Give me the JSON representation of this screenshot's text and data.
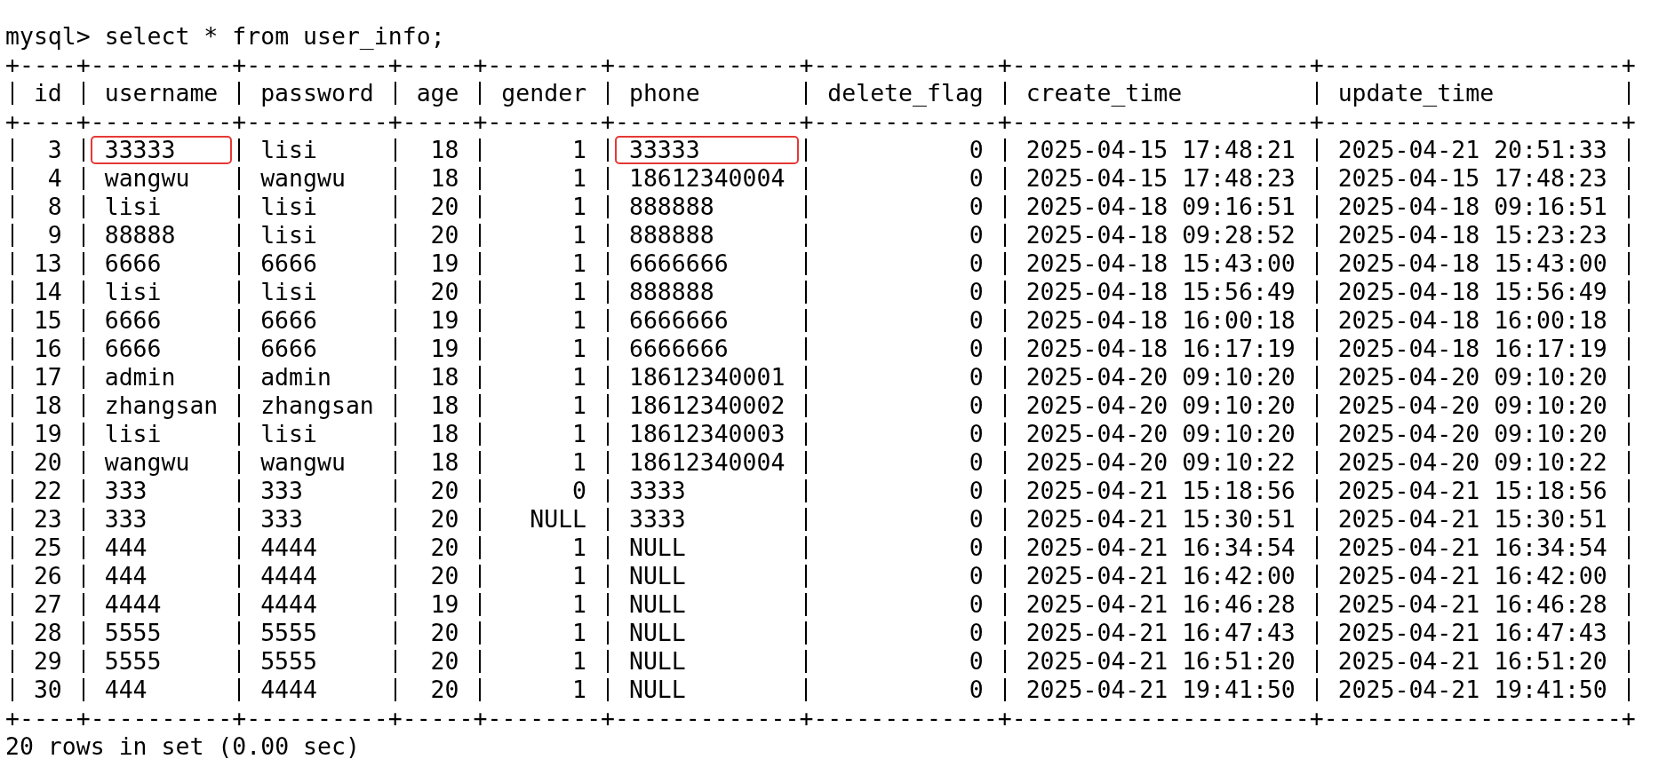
{
  "prompt": "mysql> select * from user_info;",
  "table": {
    "top_border": "+----+----------+----------+-----+--------+-------------+-------------+---------------------+---------------------+",
    "columns": [
      {
        "label": "id",
        "right_aligned": true
      },
      {
        "label": "username",
        "right_aligned": false
      },
      {
        "label": "password",
        "right_aligned": false
      },
      {
        "label": "age",
        "right_aligned": true
      },
      {
        "label": "gender",
        "right_aligned": true
      },
      {
        "label": "phone",
        "right_aligned": false
      },
      {
        "label": "delete_flag",
        "right_aligned": true
      },
      {
        "label": "create_time"
      },
      {
        "label": "update_time"
      }
    ],
    "header_border": "+----+----------+----------+-----+--------+-------------+-------------+---------------------+---------------------+",
    "rows": [
      {
        "cells": [
          "3",
          "33333",
          "lisi",
          "18",
          "1",
          "33333",
          "0",
          "2025-04-15 17:48:21",
          "2025-04-21 20:51:33"
        ],
        "marked": [
          false,
          true,
          false,
          false,
          false,
          true,
          false,
          false,
          false
        ]
      },
      {
        "cells": [
          "4",
          "wangwu",
          "wangwu",
          "18",
          "1",
          "18612340004",
          "0",
          "2025-04-15 17:48:23",
          "2025-04-15 17:48:23"
        ],
        "marked": [
          false,
          false,
          false,
          false,
          false,
          false,
          false,
          false,
          false
        ]
      },
      {
        "cells": [
          "8",
          "lisi",
          "lisi",
          "20",
          "1",
          "888888",
          "0",
          "2025-04-18 09:16:51",
          "2025-04-18 09:16:51"
        ],
        "marked": [
          false,
          false,
          false,
          false,
          false,
          false,
          false,
          false,
          false
        ]
      },
      {
        "cells": [
          "9",
          "88888",
          "lisi",
          "20",
          "1",
          "888888",
          "0",
          "2025-04-18 09:28:52",
          "2025-04-18 15:23:23"
        ],
        "marked": [
          false,
          false,
          false,
          false,
          false,
          false,
          false,
          false,
          false
        ]
      },
      {
        "cells": [
          "13",
          "6666",
          "6666",
          "19",
          "1",
          "6666666",
          "0",
          "2025-04-18 15:43:00",
          "2025-04-18 15:43:00"
        ],
        "marked": [
          false,
          false,
          false,
          false,
          false,
          false,
          false,
          false,
          false
        ]
      },
      {
        "cells": [
          "14",
          "lisi",
          "lisi",
          "20",
          "1",
          "888888",
          "0",
          "2025-04-18 15:56:49",
          "2025-04-18 15:56:49"
        ],
        "marked": [
          false,
          false,
          false,
          false,
          false,
          false,
          false,
          false,
          false
        ]
      },
      {
        "cells": [
          "15",
          "6666",
          "6666",
          "19",
          "1",
          "6666666",
          "0",
          "2025-04-18 16:00:18",
          "2025-04-18 16:00:18"
        ],
        "marked": [
          false,
          false,
          false,
          false,
          false,
          false,
          false,
          false,
          false
        ]
      },
      {
        "cells": [
          "16",
          "6666",
          "6666",
          "19",
          "1",
          "6666666",
          "0",
          "2025-04-18 16:17:19",
          "2025-04-18 16:17:19"
        ],
        "marked": [
          false,
          false,
          false,
          false,
          false,
          false,
          false,
          false,
          false
        ]
      },
      {
        "cells": [
          "17",
          "admin",
          "admin",
          "18",
          "1",
          "18612340001",
          "0",
          "2025-04-20 09:10:20",
          "2025-04-20 09:10:20"
        ],
        "marked": [
          false,
          false,
          false,
          false,
          false,
          false,
          false,
          false,
          false
        ]
      },
      {
        "cells": [
          "18",
          "zhangsan",
          "zhangsan",
          "18",
          "1",
          "18612340002",
          "0",
          "2025-04-20 09:10:20",
          "2025-04-20 09:10:20"
        ],
        "marked": [
          false,
          false,
          false,
          false,
          false,
          false,
          false,
          false,
          false
        ]
      },
      {
        "cells": [
          "19",
          "lisi",
          "lisi",
          "18",
          "1",
          "18612340003",
          "0",
          "2025-04-20 09:10:20",
          "2025-04-20 09:10:20"
        ],
        "marked": [
          false,
          false,
          false,
          false,
          false,
          false,
          false,
          false,
          false
        ]
      },
      {
        "cells": [
          "20",
          "wangwu",
          "wangwu",
          "18",
          "1",
          "18612340004",
          "0",
          "2025-04-20 09:10:22",
          "2025-04-20 09:10:22"
        ],
        "marked": [
          false,
          false,
          false,
          false,
          false,
          false,
          false,
          false,
          false
        ]
      },
      {
        "cells": [
          "22",
          "333",
          "333",
          "20",
          "0",
          "3333",
          "0",
          "2025-04-21 15:18:56",
          "2025-04-21 15:18:56"
        ],
        "marked": [
          false,
          false,
          false,
          false,
          false,
          false,
          false,
          false,
          false
        ]
      },
      {
        "cells": [
          "23",
          "333",
          "333",
          "20",
          "NULL",
          "3333",
          "0",
          "2025-04-21 15:30:51",
          "2025-04-21 15:30:51"
        ],
        "marked": [
          false,
          false,
          false,
          false,
          false,
          false,
          false,
          false,
          false
        ]
      },
      {
        "cells": [
          "25",
          "444",
          "4444",
          "20",
          "1",
          "NULL",
          "0",
          "2025-04-21 16:34:54",
          "2025-04-21 16:34:54"
        ],
        "marked": [
          false,
          false,
          false,
          false,
          false,
          false,
          false,
          false,
          false
        ]
      },
      {
        "cells": [
          "26",
          "444",
          "4444",
          "20",
          "1",
          "NULL",
          "0",
          "2025-04-21 16:42:00",
          "2025-04-21 16:42:00"
        ],
        "marked": [
          false,
          false,
          false,
          false,
          false,
          false,
          false,
          false,
          false
        ]
      },
      {
        "cells": [
          "27",
          "4444",
          "4444",
          "19",
          "1",
          "NULL",
          "0",
          "2025-04-21 16:46:28",
          "2025-04-21 16:46:28"
        ],
        "marked": [
          false,
          false,
          false,
          false,
          false,
          false,
          false,
          false,
          false
        ]
      },
      {
        "cells": [
          "28",
          "5555",
          "5555",
          "20",
          "1",
          "NULL",
          "0",
          "2025-04-21 16:47:43",
          "2025-04-21 16:47:43"
        ],
        "marked": [
          false,
          false,
          false,
          false,
          false,
          false,
          false,
          false,
          false
        ]
      },
      {
        "cells": [
          "29",
          "5555",
          "5555",
          "20",
          "1",
          "NULL",
          "0",
          "2025-04-21 16:51:20",
          "2025-04-21 16:51:20"
        ],
        "marked": [
          false,
          false,
          false,
          false,
          false,
          false,
          false,
          false,
          false
        ]
      },
      {
        "cells": [
          "30",
          "444",
          "4444",
          "20",
          "1",
          "NULL",
          "0",
          "2025-04-21 19:41:50",
          "2025-04-21 19:41:50"
        ],
        "marked": [
          false,
          false,
          false,
          false,
          false,
          false,
          false,
          false,
          false
        ]
      }
    ],
    "bottom_border": "+----+----------+----------+-----+--------+-------------+-------------+---------------------+---------------------+"
  },
  "result_summary": "20 rows in set (0.00 sec)"
}
